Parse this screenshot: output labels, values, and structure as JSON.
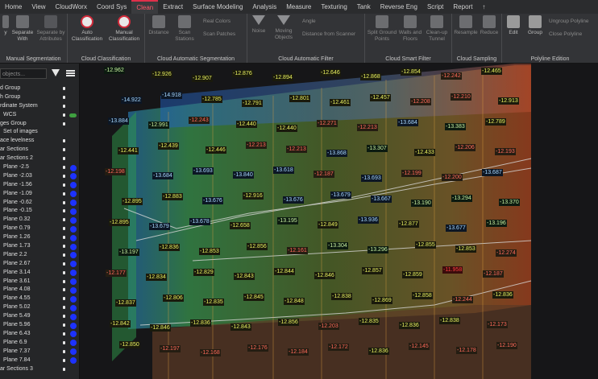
{
  "menu": [
    "Home",
    "View",
    "CloudWorx",
    "Coord Sys",
    "Clean",
    "Extract",
    "Surface Modeling",
    "Analysis",
    "Measure",
    "Texturing",
    "Tank",
    "Reverse Eng",
    "Script",
    "Report",
    "↑"
  ],
  "menu_active": 4,
  "ribbon": {
    "group_manual_seg": {
      "label": "Manual Segmentation",
      "b1": "y",
      "b2": "Separate With",
      "b3": "Separate by Attributes"
    },
    "group_cloud_class": {
      "label": "Cloud Classification",
      "auto": "Auto Classification",
      "manual": "Manual Classification"
    },
    "group_auto_seg": {
      "label": "Cloud Automatic Segmentation",
      "distance": "Distance",
      "scan_stations": "Scan Stations",
      "real_colors": "Real Colors",
      "scan_patches": "Scan Patches"
    },
    "group_auto_filter": {
      "label": "Cloud Automatic Filter",
      "noise": "Noise",
      "moving": "Moving Objects",
      "angle": "Angle",
      "dist_scanner": "Distance from Scanner"
    },
    "group_smart_filter": {
      "label": "Cloud Smart Filter",
      "split": "Split Ground Points",
      "walls": "Walls and Floors",
      "cleanup": "Clean-up Tunnel"
    },
    "group_sampling": {
      "label": "Cloud Sampling",
      "resample": "Resample",
      "reduce": "Reduce"
    },
    "group_polyline": {
      "label": "Polyline Edition",
      "edit": "Edit",
      "group": "Group",
      "ungroup": "Ungroup Polyline",
      "close": "Close Polyline"
    }
  },
  "panel": {
    "search_placeholder": "objects...",
    "tree": [
      {
        "text": "d Group",
        "pin": true,
        "dot": false
      },
      {
        "text": "h Group",
        "pin": true,
        "dot": false
      },
      {
        "text": "rdinate System",
        "pin": true,
        "dot": false
      },
      {
        "text": "WCS",
        "pin": true,
        "dot": false,
        "toggle": true,
        "indent": true
      },
      {
        "text": "ges Group",
        "pin": true,
        "dot": false
      },
      {
        "text": "Set of images",
        "pin": false,
        "dot": false,
        "indent": true
      },
      {
        "text": "ace levelness",
        "pin": true,
        "dot": false
      },
      {
        "text": "ar Sections",
        "pin": true,
        "dot": false
      },
      {
        "text": "ar Sections 2",
        "pin": true,
        "dot": false
      },
      {
        "text": "Plane -2.5",
        "pin": true,
        "dot": true,
        "indent": true
      },
      {
        "text": "Plane -2.03",
        "pin": true,
        "dot": true,
        "indent": true
      },
      {
        "text": "Plane -1.56",
        "pin": true,
        "dot": true,
        "indent": true
      },
      {
        "text": "Plane -1.09",
        "pin": true,
        "dot": true,
        "indent": true
      },
      {
        "text": "Plane -0.62",
        "pin": true,
        "dot": true,
        "indent": true
      },
      {
        "text": "Plane -0.15",
        "pin": true,
        "dot": true,
        "indent": true
      },
      {
        "text": "Plane 0.32",
        "pin": true,
        "dot": true,
        "indent": true
      },
      {
        "text": "Plane 0.79",
        "pin": true,
        "dot": true,
        "indent": true
      },
      {
        "text": "Plane 1.26",
        "pin": true,
        "dot": true,
        "indent": true
      },
      {
        "text": "Plane 1.73",
        "pin": true,
        "dot": true,
        "indent": true
      },
      {
        "text": "Plane 2.2",
        "pin": true,
        "dot": true,
        "indent": true
      },
      {
        "text": "Plane 2.67",
        "pin": true,
        "dot": true,
        "indent": true
      },
      {
        "text": "Plane 3.14",
        "pin": true,
        "dot": true,
        "indent": true
      },
      {
        "text": "Plane 3.61",
        "pin": true,
        "dot": true,
        "indent": true
      },
      {
        "text": "Plane 4.08",
        "pin": true,
        "dot": true,
        "indent": true
      },
      {
        "text": "Plane 4.55",
        "pin": true,
        "dot": true,
        "indent": true
      },
      {
        "text": "Plane 5.02",
        "pin": true,
        "dot": true,
        "indent": true
      },
      {
        "text": "Plane 5.49",
        "pin": true,
        "dot": true,
        "indent": true
      },
      {
        "text": "Plane 5.96",
        "pin": true,
        "dot": true,
        "indent": true
      },
      {
        "text": "Plane 6.43",
        "pin": true,
        "dot": true,
        "indent": true
      },
      {
        "text": "Plane 6.9",
        "pin": true,
        "dot": true,
        "indent": true
      },
      {
        "text": "Plane 7.37",
        "pin": true,
        "dot": true,
        "indent": true
      },
      {
        "text": "Plane 7.84",
        "pin": true,
        "dot": true,
        "indent": true
      },
      {
        "text": "ar Sections 3",
        "pin": true,
        "dot": false
      }
    ]
  },
  "viewport": {
    "elevations": [
      "-12.962",
      "-12.926",
      "-12.907",
      "-12.876",
      "-12.894",
      "-12.646",
      "-12.868",
      "-12.854",
      "-12.242",
      "-12.465",
      "-14.922",
      "-14.918",
      "-12.785",
      "-12.791",
      "-12.801",
      "-12.461",
      "-12.457",
      "-12.208",
      "-12.210",
      "-12.913",
      "-13.884",
      "-12.991",
      "-12.243",
      "-12.440",
      "-12.440",
      "-12.271",
      "-12.213",
      "-13.684",
      "-13.383",
      "-12.789",
      "-12.441",
      "-12.439",
      "-12.446",
      "-12.213",
      "-12.213",
      "-13.868",
      "-13.307",
      "-12.433",
      "-12.206",
      "-12.193",
      "-12.198",
      "-13.684",
      "-13.693",
      "-13.840",
      "-13.618",
      "-12.187",
      "-13.693",
      "-12.199",
      "-12.200",
      "-13.687",
      "-12.895",
      "-12.883",
      "-13.676",
      "-12.916",
      "-13.676",
      "-13.679",
      "-13.667",
      "-13.190",
      "-13.294",
      "-13.370",
      "-12.895",
      "-13.679",
      "-13.678",
      "-12.658",
      "-13.195",
      "-12.849",
      "-13.936",
      "-12.877",
      "-13.677",
      "-13.196",
      "-13.197",
      "-12.836",
      "-12.853",
      "-12.856",
      "-12.161",
      "-13.304",
      "-13.296",
      "-12.855",
      "-12.853",
      "-12.274",
      "-12.177",
      "-12.834",
      "-12.829",
      "-12.843",
      "-12.844",
      "-12.846",
      "-12.857",
      "-12.859",
      "-11.958",
      "-12.187",
      "-12.837",
      "-12.806",
      "-12.835",
      "-12.845",
      "-12.848",
      "-12.838",
      "-12.869",
      "-12.858",
      "-12.244",
      "-12.836",
      "-12.842",
      "-12.846",
      "-12.836",
      "-12.843",
      "-12.856",
      "-12.203",
      "-12.835",
      "-12.836",
      "-12.838",
      "-12.173",
      "-12.850",
      "-12.197",
      "-12.168",
      "-12.176",
      "-12.184",
      "-12.172",
      "-12.836",
      "-12.145",
      "-12.178",
      "-12.190"
    ]
  }
}
